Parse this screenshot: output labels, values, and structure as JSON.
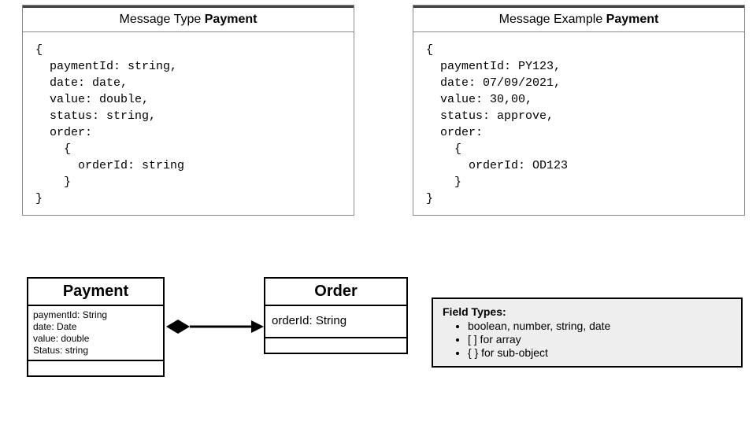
{
  "msg_type": {
    "title_prefix": "Message Type ",
    "title_bold": "Payment",
    "body": "{\n  paymentId: string,\n  date: date,\n  value: double,\n  status: string,\n  order:\n    {\n      orderId: string\n    }\n}"
  },
  "msg_example": {
    "title_prefix": "Message Example ",
    "title_bold": "Payment",
    "body": "{\n  paymentId: PY123,\n  date: 07/09/2021,\n  value: 30,00,\n  status: approve,\n  order:\n    {\n      orderId: OD123\n    }\n}"
  },
  "uml_payment": {
    "title": "Payment",
    "attrs": "paymentId: String\ndate: Date\nvalue: double\nStatus: string"
  },
  "uml_order": {
    "title": "Order",
    "attrs": "orderId: String"
  },
  "legend": {
    "title": "Field Types:",
    "item1": "boolean, number, string, date",
    "item2": "[ ] for array",
    "item3": "{ } for sub-object"
  }
}
